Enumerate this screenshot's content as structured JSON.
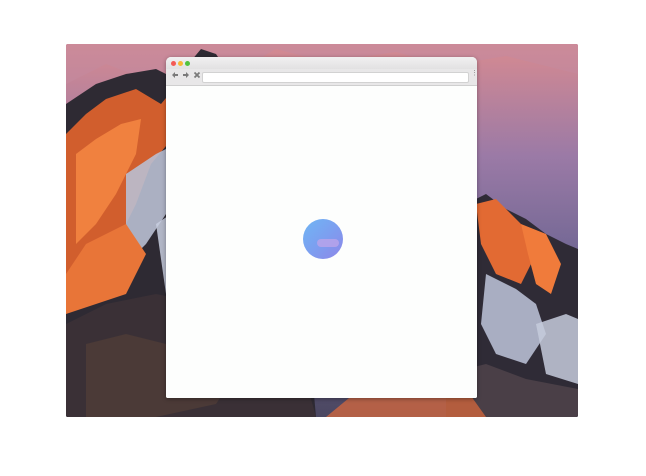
{
  "desktop": {
    "wallpaper": "mountain-wallpaper",
    "colors": {
      "sky": "#8c6f9f",
      "rock_lit": "#e36c34",
      "snow": "#b9bfd2",
      "shadow": "#2f2b33"
    }
  },
  "browser": {
    "traffic_lights": {
      "close": "#f45b55",
      "minimize": "#f8b935",
      "maximize": "#52c33e"
    },
    "toolbar": {
      "back_icon": "arrow-left-icon",
      "forward_icon": "arrow-right-icon",
      "stop_icon": "close-x-icon",
      "address_value": "",
      "menu_icon": "vertical-dots-icon"
    },
    "content": {
      "loader_icon": "loading-orb-icon",
      "loader_colors": [
        "#6fb6f4",
        "#8e86e8"
      ]
    }
  }
}
